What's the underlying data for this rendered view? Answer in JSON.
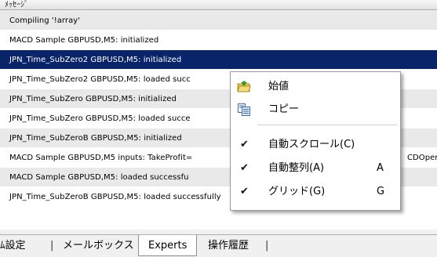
{
  "log": {
    "header": "ﾒｯｾｰｼﾞ",
    "rows": [
      "Compiling '!array'",
      "MACD Sample GBPUSD,M5: initialized",
      "JPN_Time_SubZero2 GBPUSD,M5: initialized",
      "JPN_Time_SubZero2 GBPUSD,M5: loaded succ",
      "JPN_Time_SubZero GBPUSD,M5: initialized",
      "JPN_Time_SubZero GBPUSD,M5: loaded succe",
      "JPN_Time_SubZeroB GBPUSD,M5: initialized",
      "MACD Sample GBPUSD,M5 inputs: TakeProfit=",
      "MACD Sample GBPUSD,M5: loaded successfu",
      "JPN_Time_SubZeroB GBPUSD,M5: loaded successfully"
    ],
    "row7_tail": "CDOper"
  },
  "tabs": {
    "t1": "ﾑ設定",
    "t2": "メールボックス",
    "t3": "Experts",
    "t4": "操作履歴"
  },
  "menu": {
    "open": "始値",
    "copy": "コピー",
    "autoscroll": "自動スクロール(C)",
    "autoarrange": "自動整列(A)",
    "autoarrange_key": "A",
    "grid": "グリッド(G)",
    "grid_key": "G"
  },
  "colors": {
    "selection": "#0a246a",
    "alt_row": "#e9e9e9"
  }
}
